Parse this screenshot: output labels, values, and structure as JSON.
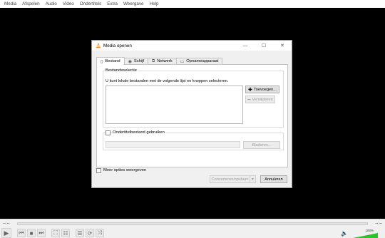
{
  "menubar": {
    "items": [
      "Media",
      "Afspelen",
      "Audio",
      "Video",
      "Ondertitels",
      "Extra",
      "Weergave",
      "Help"
    ]
  },
  "player": {
    "time_elapsed": "--:--",
    "time_total": "--:--",
    "volume_percent_label": "100%",
    "volume_level": 1.0,
    "seek_progress": 0,
    "colors": {
      "volume_fill": "#2ec12e",
      "background": "#000000"
    }
  },
  "dialog": {
    "title": "Media openen",
    "window_buttons": {
      "minimize": "—",
      "maximize": "☐",
      "close": "✕"
    },
    "tabs": [
      {
        "label": "Bestand",
        "icon": "file-icon",
        "active": true
      },
      {
        "label": "Schijf",
        "icon": "disc-icon",
        "active": false
      },
      {
        "label": "Netwerk",
        "icon": "network-icon",
        "active": false
      },
      {
        "label": "Opnameapparaat",
        "icon": "capture-icon",
        "active": false
      }
    ],
    "file_selection": {
      "group_title": "Bestandsselectie",
      "hint": "U kunt lokale bestanden met de volgende lijst en knoppen selecteren.",
      "add_button": "Toevoegen...",
      "remove_button": "Verwijderen"
    },
    "subtitle": {
      "checkbox_label": "Ondertitelbestand gebruiken",
      "browse_button": "Bladeren..."
    },
    "more_options_label": "Meer opties weergeven",
    "convert_button": "Converteren/opslaan",
    "cancel_button": "Annuleren",
    "colors": {
      "accent_cone": "#f58220"
    }
  }
}
